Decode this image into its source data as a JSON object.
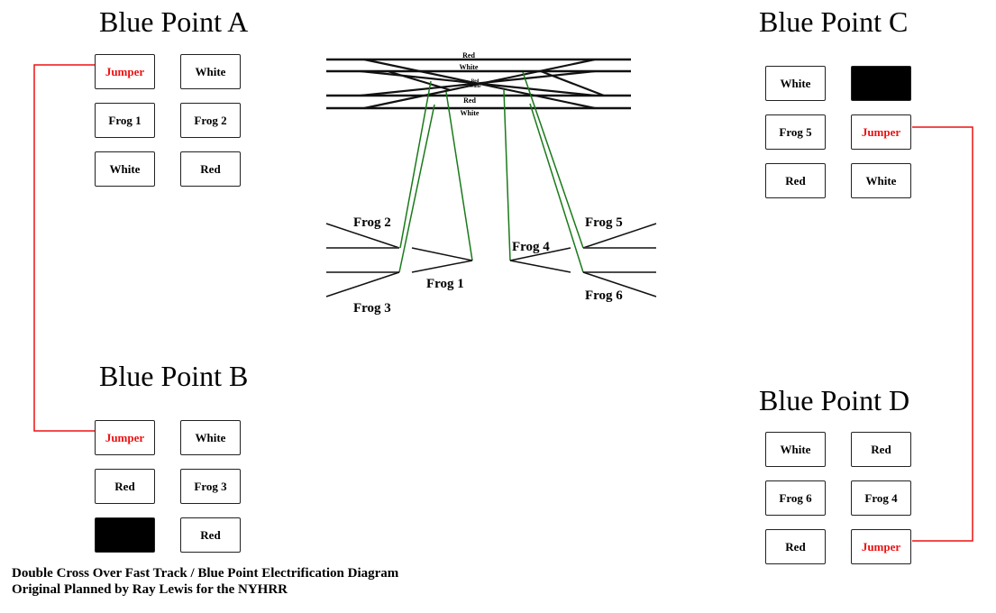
{
  "colors": {
    "jumper_wire": "#ee1111",
    "feeder_wire": "#1a7a1a",
    "track": "#111111"
  },
  "blue_points": [
    {
      "id": "A",
      "title": "Blue Point A",
      "terminals": [
        {
          "label": "Jumper",
          "type": "jumper"
        },
        {
          "label": "White",
          "type": "normal"
        },
        {
          "label": "Frog 1",
          "type": "normal"
        },
        {
          "label": "Frog 2",
          "type": "normal"
        },
        {
          "label": "White",
          "type": "normal"
        },
        {
          "label": "Red",
          "type": "normal"
        }
      ]
    },
    {
      "id": "B",
      "title": "Blue Point B",
      "terminals": [
        {
          "label": "Jumper",
          "type": "jumper"
        },
        {
          "label": "White",
          "type": "normal"
        },
        {
          "label": "Red",
          "type": "normal"
        },
        {
          "label": "Frog 3",
          "type": "normal"
        },
        {
          "label": "",
          "type": "blank"
        },
        {
          "label": "Red",
          "type": "normal"
        }
      ]
    },
    {
      "id": "C",
      "title": "Blue Point C",
      "terminals": [
        {
          "label": "White",
          "type": "normal"
        },
        {
          "label": "",
          "type": "blank"
        },
        {
          "label": "Frog 5",
          "type": "normal"
        },
        {
          "label": "Jumper",
          "type": "jumper"
        },
        {
          "label": "Red",
          "type": "normal"
        },
        {
          "label": "White",
          "type": "normal"
        }
      ]
    },
    {
      "id": "D",
      "title": "Blue Point D",
      "terminals": [
        {
          "label": "White",
          "type": "normal"
        },
        {
          "label": "Red",
          "type": "normal"
        },
        {
          "label": "Frog 6",
          "type": "normal"
        },
        {
          "label": "Frog 4",
          "type": "normal"
        },
        {
          "label": "Red",
          "type": "normal"
        },
        {
          "label": "Jumper",
          "type": "jumper"
        }
      ]
    }
  ],
  "track": {
    "rail_labels": [
      "Red",
      "White",
      "Red",
      "White",
      "Red",
      "White"
    ],
    "frog_labels": [
      "Frog 1",
      "Frog 2",
      "Frog 3",
      "Frog 4",
      "Frog 5",
      "Frog 6"
    ]
  },
  "jumpers": [
    {
      "from": "Blue Point A Jumper",
      "to": "Blue Point B Jumper"
    },
    {
      "from": "Blue Point C Jumper",
      "to": "Blue Point D Jumper"
    }
  ],
  "footer": {
    "line1": "Double Cross Over Fast Track / Blue Point Electrification Diagram",
    "line2": "Original Planned by Ray Lewis for the NYHRR"
  }
}
